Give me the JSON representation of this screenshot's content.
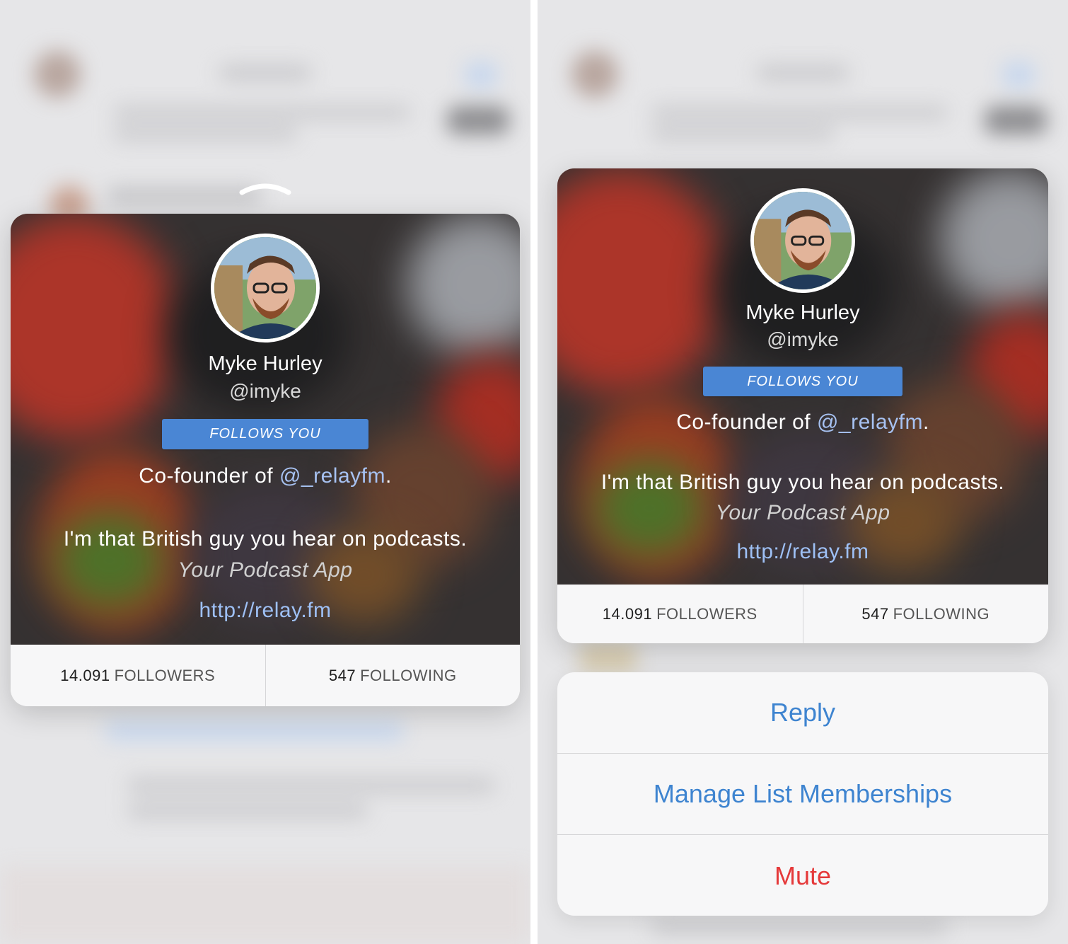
{
  "colors": {
    "accent": "#3e84d0",
    "badge": "#4a86d4",
    "destructive": "#e5393a",
    "link": "#9ec0f5"
  },
  "profile": {
    "name": "Myke Hurley",
    "handle": "@imyke",
    "follows_badge": "FOLLOWS YOU",
    "bio_prefix": "Co-founder of ",
    "bio_mention": "@_relayfm",
    "bio_suffix": ".",
    "bio_line2": "I'm that British guy you hear on podcasts.",
    "app_name": "Your Podcast App",
    "url": "http://relay.fm",
    "followers_count": "14.091",
    "followers_label": "FOLLOWERS",
    "following_count": "547",
    "following_label": "FOLLOWING"
  },
  "actions": [
    {
      "label": "Reply"
    },
    {
      "label": "Manage List Memberships"
    },
    {
      "label": "Mute"
    }
  ],
  "icons": {
    "peek_indicator": "chevron-up-icon",
    "avatar": "profile-avatar"
  }
}
